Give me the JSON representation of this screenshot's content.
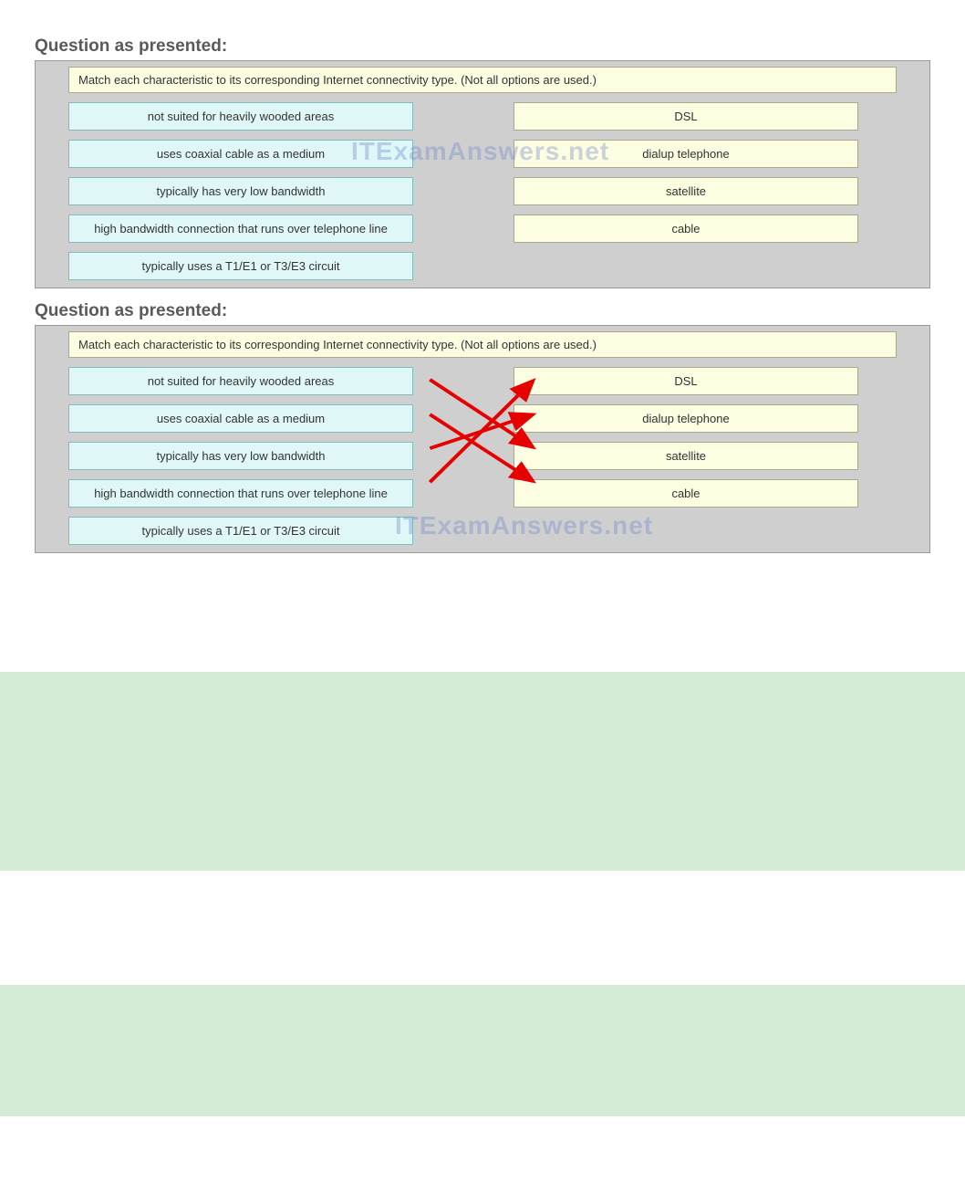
{
  "heading": "Question as presented:",
  "instruction": "Match each characteristic to its corresponding Internet connectivity type. (Not all options are used.)",
  "leftOptions": [
    "not suited for heavily wooded areas",
    "uses coaxial cable as a medium",
    "typically has very low bandwidth",
    "high bandwidth connection that runs over telephone line",
    "typically uses a T1/E1 or T3/E3 circuit"
  ],
  "rightOptions": [
    "DSL",
    "dialup telephone",
    "satellite",
    "cable"
  ],
  "watermark": "ITExamAnswers.net"
}
